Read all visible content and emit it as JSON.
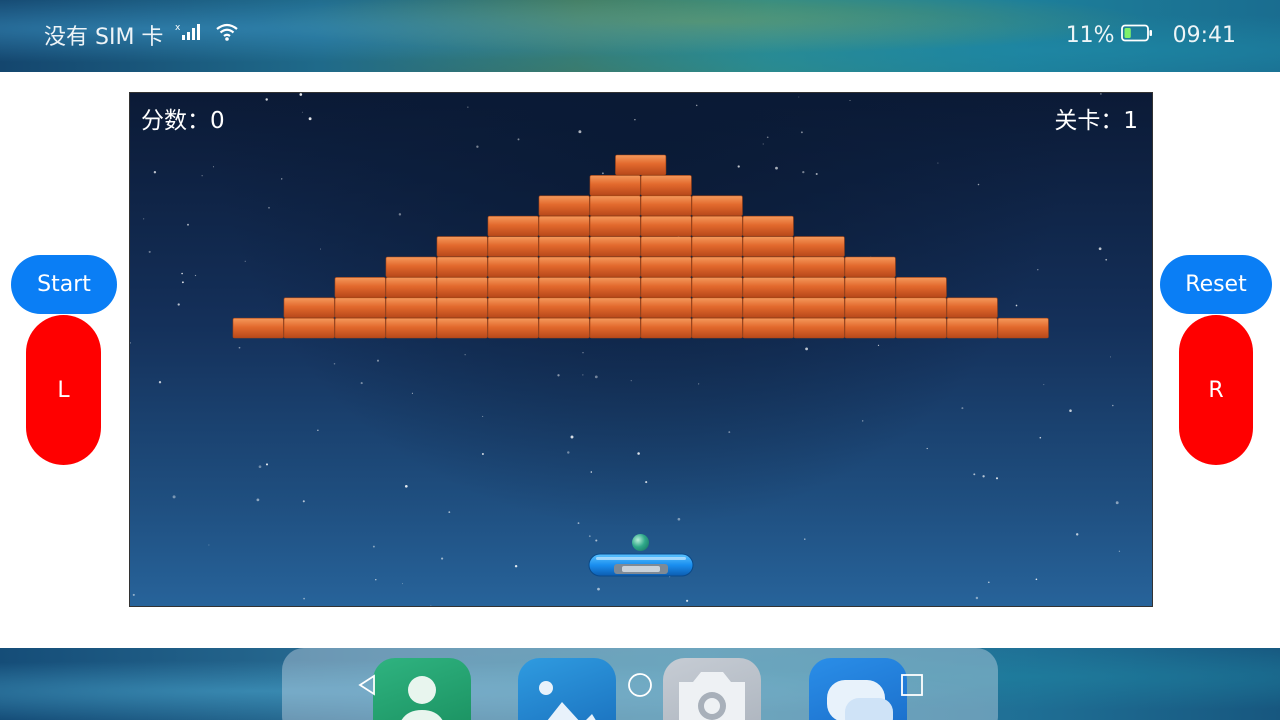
{
  "status_bar": {
    "carrier_text": "没有 SIM 卡",
    "battery_percent": "11%",
    "battery_level": 0.11,
    "time": "09:41",
    "icons": [
      "signal-icon",
      "wifi-icon",
      "battery-icon"
    ]
  },
  "game": {
    "score_text": "分数：0",
    "level_text": "关卡：1",
    "bricks": {
      "rows_bricks_per_row": [
        1,
        2,
        4,
        6,
        8,
        10,
        12,
        14,
        16
      ],
      "color": "#e2692d"
    },
    "ball_color": "#2fa98a",
    "paddle_color": "#1a8ff0"
  },
  "controls": {
    "start_label": "Start",
    "reset_label": "Reset",
    "left_label": "L",
    "right_label": "R",
    "primary_color": "#0a7ef5",
    "direction_color": "#ff0000"
  },
  "dock": {
    "apps": [
      "contacts-app-icon",
      "gallery-app-icon",
      "camera-app-icon",
      "messages-app-icon"
    ]
  },
  "navigation": {
    "keys": [
      "back-icon",
      "home-icon",
      "recent-apps-icon"
    ]
  }
}
